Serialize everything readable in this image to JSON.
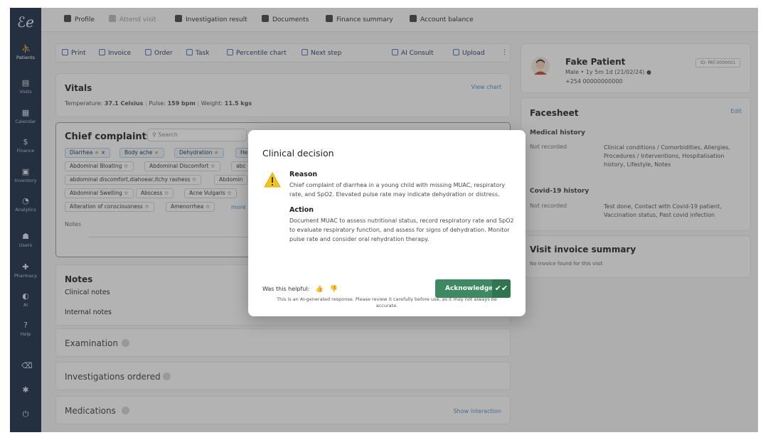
{
  "sidebar": {
    "logo": "ℰℯ",
    "items": [
      {
        "label": "Patients",
        "icon": "patients-icon",
        "glyph": "⛹"
      },
      {
        "label": "Visits",
        "icon": "visits-icon",
        "glyph": "▤"
      },
      {
        "label": "Calendar",
        "icon": "calendar-icon",
        "glyph": "▦"
      },
      {
        "label": "Finance",
        "icon": "finance-icon",
        "glyph": "$"
      },
      {
        "label": "Inventory",
        "icon": "inventory-icon",
        "glyph": "▣"
      },
      {
        "label": "Analytics",
        "icon": "analytics-icon",
        "glyph": "◔"
      },
      {
        "label": "Users",
        "icon": "users-icon",
        "glyph": "☗"
      },
      {
        "label": "Pharmacy",
        "icon": "pharmacy-icon",
        "glyph": "✚"
      },
      {
        "label": "AI",
        "icon": "ai-icon",
        "glyph": "◐"
      },
      {
        "label": "Help",
        "icon": "help-icon",
        "glyph": "?"
      }
    ],
    "bottom_icons": [
      "broom-icon",
      "settings-icon",
      "power-icon"
    ]
  },
  "top_nav": [
    "Profile",
    "Attend visit",
    "Investigation result",
    "Documents",
    "Finance summary",
    "Account balance"
  ],
  "toolbar": {
    "print": "Print",
    "invoice": "Invoice",
    "order": "Order",
    "task": "Task",
    "percentile_chart": "Percentile chart",
    "next_step": "Next step",
    "ai_consult": "AI Consult",
    "upload": "Upload",
    "more": "⋮"
  },
  "vitals": {
    "title": "Vitals",
    "view_chart": "View chart",
    "temperature_label": "Temperature:",
    "temperature": "37.1 Celsius",
    "pulse_label": "Pulse:",
    "pulse": "159 bpm",
    "weight_label": "Weight:",
    "weight": "11.5 kgs"
  },
  "chief_complaints": {
    "title": "Chief complaints",
    "search_placeholder": "Search",
    "selected": [
      "Diarrhea",
      "Body ache",
      "Dehydration",
      "He"
    ],
    "suggestions_row1": [
      "Abdominal Bloating",
      "Abdominal Discomfort",
      "abc"
    ],
    "suggestions_row2": [
      "abdominal discomfort,diahoear,itchy rashess",
      "Abdomin"
    ],
    "suggestions_row3": [
      "Abdominal Swelling",
      "Abscess",
      "Acne Vulgaris"
    ],
    "suggestions_row4": [
      "Alteration of consciousness",
      "Amenorrhea"
    ],
    "more": "more",
    "notes_label": "Notes"
  },
  "notes": {
    "title": "Notes",
    "clinical": "Clinical notes",
    "internal": "Internal notes"
  },
  "sections": {
    "examination": "Examination",
    "investigations": "Investigations ordered",
    "medications": "Medications",
    "show_interaction": "Show interaction"
  },
  "patient": {
    "name": "Fake Patient",
    "id": "ID: PAT-0000001",
    "meta": "Male • 1y 5m 1d (21/02/24)",
    "phone": "+254 00000000000"
  },
  "facesheet": {
    "title": "Facesheet",
    "edit": "Edit",
    "medical_history_title": "Medical history",
    "medical_status": "Not recorded",
    "medical_details": "Clinical conditions / Comorbidities, Allergies, Procedures / Interventions, Hospitalisation history, Lifestyle, Notes",
    "covid_title": "Covid-19 history",
    "covid_status": "Not recorded",
    "covid_details": "Test done, Contact with Covid-19 patient, Vaccination status, Past covid infection"
  },
  "invoice_summary": {
    "title": "Visit invoice summary",
    "empty": "No invoice found for this visit"
  },
  "modal": {
    "title": "Clinical decision",
    "reason_title": "Reason",
    "reason_body": "Chief complaint of diarrhea in a young child with missing MUAC, respiratory rate, and SpO2. Elevated pulse rate may indicate dehydration or distress.",
    "action_title": "Action",
    "action_body": "Document MUAC to assess nutritional status, record respiratory rate and SpO2 to evaluate respiratory function, and assess for signs of dehydration. Monitor pulse rate and consider oral rehydration therapy.",
    "helpful": "Was this helpful:",
    "acknowledge": "Acknowledge",
    "disclaimer": "This is an AI-generated response. Please review it carefully before use, as it may not always be accurate."
  },
  "colors": {
    "sidebar": "#22344a",
    "accent_green": "#3d8a62",
    "link_blue": "#4f8fc2",
    "warning_yellow": "#f2c318",
    "star": "#e0a41b"
  }
}
